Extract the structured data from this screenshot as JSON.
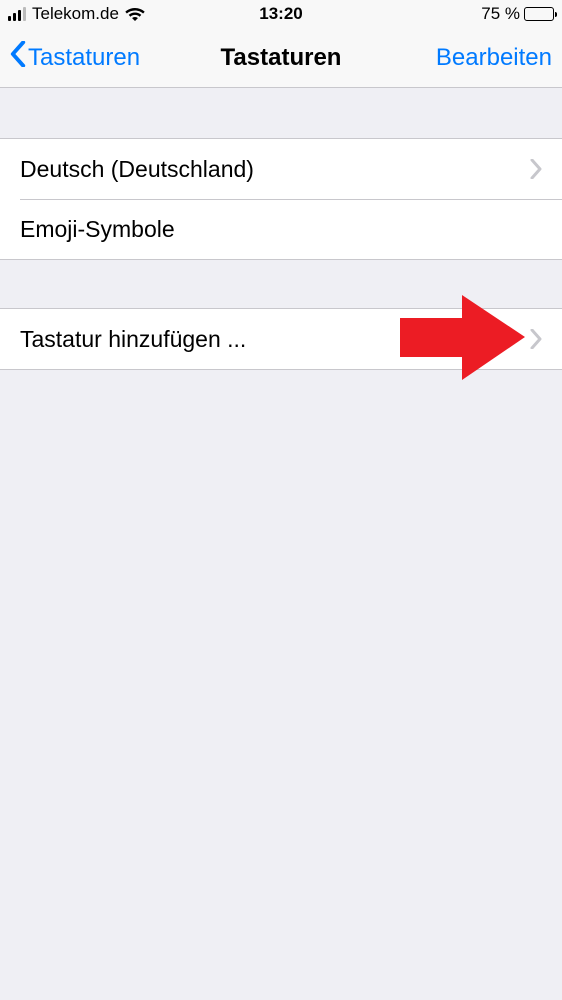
{
  "status_bar": {
    "carrier": "Telekom.de",
    "time": "13:20",
    "battery_percent": "75 %"
  },
  "nav": {
    "back_label": "Tastaturen",
    "title": "Tastaturen",
    "edit_label": "Bearbeiten"
  },
  "keyboards": {
    "items": [
      {
        "label": "Deutsch (Deutschland)",
        "has_chevron": true
      },
      {
        "label": "Emoji-Symbole",
        "has_chevron": false
      }
    ]
  },
  "add_keyboard": {
    "label": "Tastatur hinzufügen ..."
  },
  "colors": {
    "accent": "#007aff",
    "battery_low_power": "#ffcc00",
    "annotation_arrow": "#ec1c24"
  }
}
